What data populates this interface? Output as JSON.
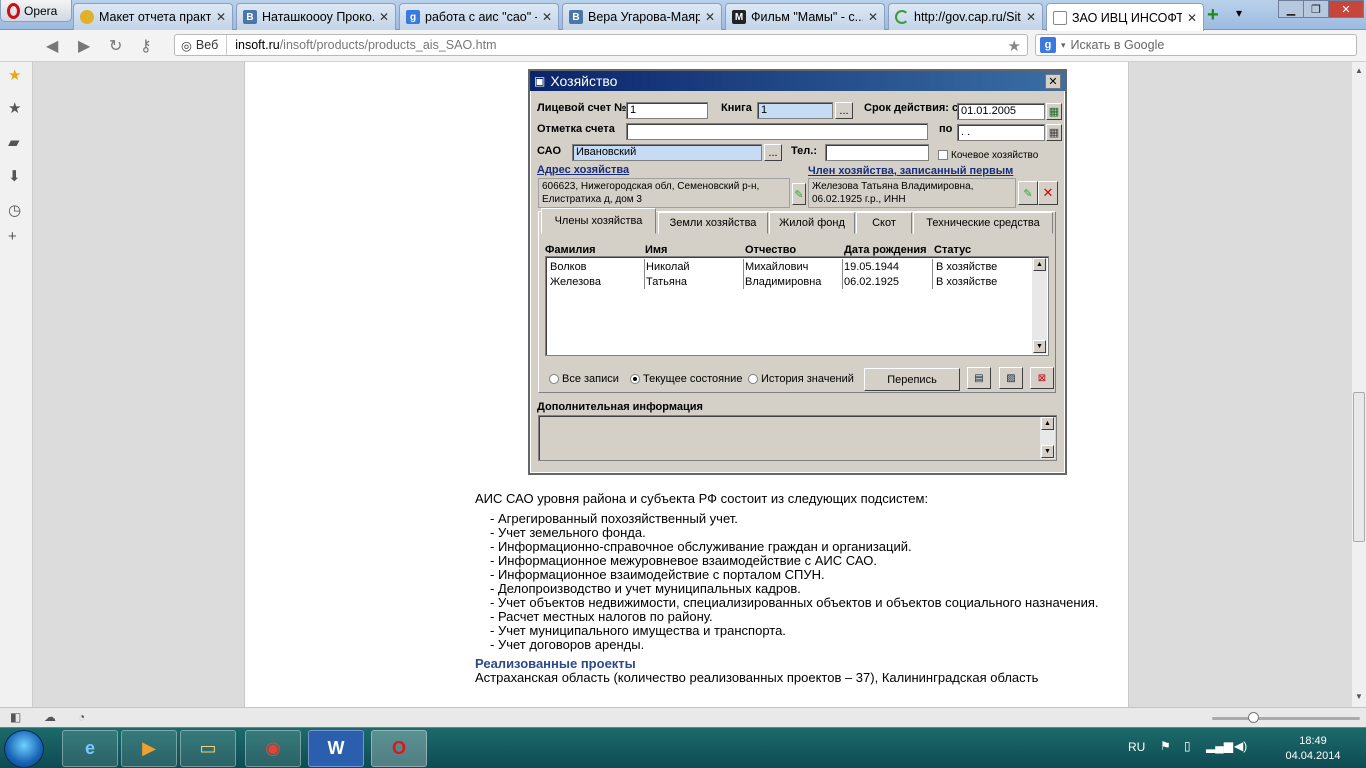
{
  "browser": {
    "menu_label": "Opera",
    "tabs": [
      {
        "title": "Макет отчета практ...",
        "icon": "chrome-icon"
      },
      {
        "title": "Наташкоооу Проко...",
        "icon": "vk-icon"
      },
      {
        "title": "работа с аис \"сао\" -...",
        "icon": "google-icon"
      },
      {
        "title": "Вера Угарова-Маяр...",
        "icon": "vk-icon"
      },
      {
        "title": "Фильм \"Мамы\" - с...",
        "icon": "m-icon"
      },
      {
        "title": "http://gov.cap.ru/Sit...",
        "icon": "loading-icon"
      },
      {
        "title": "ЗАО ИВЦ ИНСОФТ",
        "icon": "page-icon",
        "active": true
      }
    ],
    "address_prefix": "Веб",
    "url_host": "insoft.ru",
    "url_path": "/insoft/products/products_ais_SAO.htm",
    "search_placeholder": "Искать в Google"
  },
  "dialog": {
    "title": "Хозяйство",
    "account_label": "Лицевой счет №",
    "account_value": "1",
    "book_label": "Книга",
    "book_value": "1",
    "period_label": "Срок действия: с",
    "period_from": "01.01.2005",
    "period_to_label": "по",
    "period_to": ". .",
    "mark_label": "Отметка счета",
    "mark_value": "",
    "sao_label": "САО",
    "sao_value": "Ивановский",
    "phone_label": "Тел.:",
    "phone_value": "",
    "nomadic_label": "Кочевое хозяйство",
    "address_title": "Адрес хозяйства",
    "address_line1": "606623, Нижегородская обл, Семеновский р-н,",
    "address_line2": "Елистратиха д, дом 3",
    "member_title": "Член хозяйства, записанный первым",
    "member_line1": "Железова Татьяна Владимировна,",
    "member_line2": "06.02.1925 г.р., ИНН",
    "browse_label": "...",
    "tabs": [
      "Члены хозяйства",
      "Земли хозяйства",
      "Жилой фонд",
      "Скот",
      "Технические средства"
    ],
    "columns": [
      "Фамилия",
      "Имя",
      "Отчество",
      "Дата рождения",
      "Статус"
    ],
    "rows": [
      [
        "Волков",
        "Николай",
        "Михайлович",
        "19.05.1944",
        "В хозяйстве"
      ],
      [
        "Железова",
        "Татьяна",
        "Владимировна",
        "06.02.1925",
        "В хозяйстве"
      ]
    ],
    "radio_all": "Все записи",
    "radio_current": "Текущее состояние",
    "radio_history": "История значений",
    "census_button": "Перепись",
    "extra_info_label": "Дополнительная информация"
  },
  "article": {
    "intro": "АИС САО уровня района и субъекта РФ состоит из следующих подсистем:",
    "items": [
      "- Агрегированный похозяйственный учет.",
      "- Учет земельного фонда.",
      "- Информационно-справочное обслуживание граждан и организаций.",
      "- Информационное межуровневое взаимодействие с АИС САО.",
      "- Информационное взаимодействие с порталом СПУН.",
      "- Делопроизводство и учет муниципальных кадров.",
      "- Учет объектов недвижимости, специализированных объектов и объектов социального назначения.",
      "- Расчет местных налогов по району.",
      "- Учет муниципального имущества и транспорта.",
      "- Учет договоров аренды."
    ],
    "projects_heading": "Реализованные проекты",
    "projects_text": "Астраханская область (количество реализованных проектов – 37), Калининградская область"
  },
  "taskbar": {
    "language": "RU",
    "time": "18:49",
    "date": "04.04.2014"
  }
}
